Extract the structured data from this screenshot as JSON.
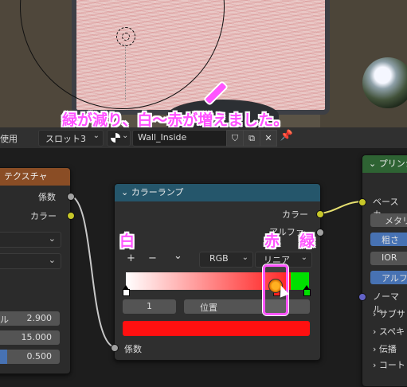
{
  "annotation": {
    "main_text": "緑が減り、白〜赤が増えました。",
    "label_white": "白",
    "label_red": "赤",
    "label_green": "緑"
  },
  "header": {
    "use_label": "使用",
    "slot_label": "スロット3",
    "material_name": "Wall_Inside"
  },
  "texture_node": {
    "title": "テクスチャ",
    "out_factor": "係数",
    "out_color": "カラー",
    "field1_label": "ル",
    "field1_value": "2.900",
    "field2_value": "15.000",
    "field3_value": "0.500"
  },
  "color_ramp": {
    "title": "カラーランプ",
    "out_color": "カラー",
    "out_alpha": "アルファ",
    "add_symbol": "+",
    "remove_symbol": "−",
    "menu_symbol": "⌄",
    "color_mode": "RGB",
    "interpolation": "リニア",
    "active_index": "1",
    "position_label": "位置",
    "in_factor": "係数",
    "stops": [
      {
        "position": 0.0,
        "color": "#ffffff"
      },
      {
        "position": 0.82,
        "color": "#ff1010"
      },
      {
        "position": 0.985,
        "color": "#00e000"
      }
    ],
    "active_color": "#ff1010"
  },
  "bsdf_node": {
    "title": "プリンシ",
    "base_color": "ベースカ",
    "metallic": "メタリ",
    "roughness": "粗さ",
    "ior": "IOR",
    "alpha": "アルフ",
    "normal": "ノーマル",
    "subsurface": "サブサ",
    "specular": "スペキ",
    "transmission": "伝播",
    "coat": "コート"
  },
  "colors": {
    "annotation_pink": "#ff55ff",
    "texture_header": "#8a4d25",
    "ramp_header": "#25566b",
    "bsdf_header": "#2e6333"
  }
}
